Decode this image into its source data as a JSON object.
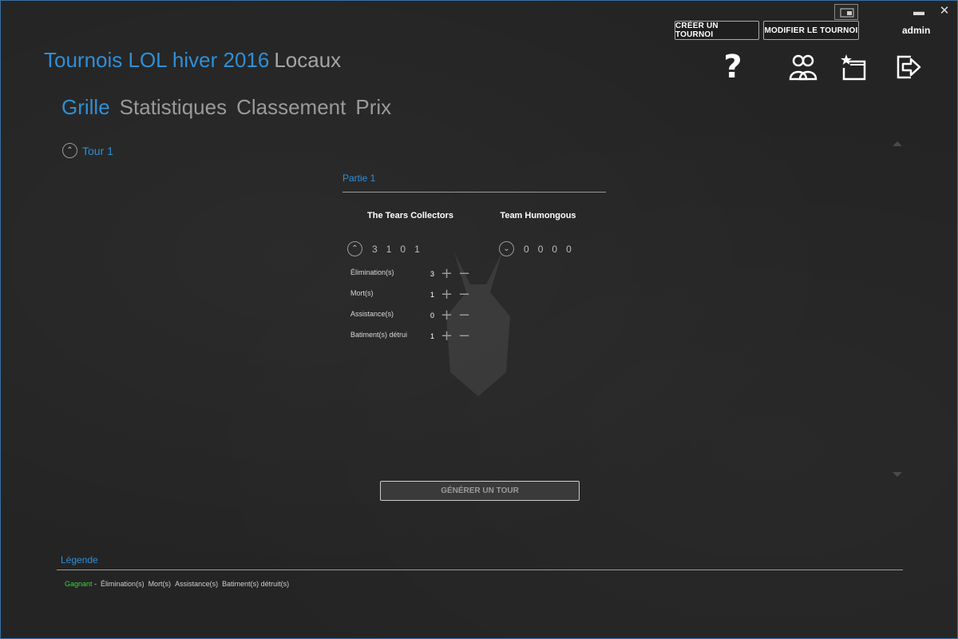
{
  "window": {
    "minimize_glyph": "▬",
    "close_glyph": "✕"
  },
  "header": {
    "create_button": "CRÉER UN TOURNOI",
    "modify_button": "MODIFIER LE TOURNOI",
    "user": "admin",
    "tournament_name": "Tournois LOL hiver 2016",
    "location": "Locaux",
    "help_glyph": "?",
    "icons": [
      "help-icon",
      "users-icon",
      "new-favorite-icon",
      "logout-icon"
    ]
  },
  "nav": {
    "tabs": [
      {
        "label": "Grille",
        "active": true
      },
      {
        "label": "Statistiques",
        "active": false
      },
      {
        "label": "Classement",
        "active": false
      },
      {
        "label": "Prix",
        "active": false
      }
    ]
  },
  "round": {
    "label": "Tour 1",
    "collapse_glyph": "⌃"
  },
  "match": {
    "title": "Partie 1",
    "team_a": {
      "name": "The Tears Collectors",
      "score": [
        "3",
        "1",
        "0",
        "1"
      ],
      "toggle_glyph": "⌃"
    },
    "team_b": {
      "name": "Team Humongous",
      "score": [
        "0",
        "0",
        "0",
        "0"
      ],
      "toggle_glyph": "⌄"
    },
    "stats": [
      {
        "label": "Élimination(s)",
        "value": "3"
      },
      {
        "label": "Mort(s)",
        "value": "1"
      },
      {
        "label": "Assistance(s)",
        "value": "0"
      },
      {
        "label": "Batiment(s) détrui",
        "value": "1"
      }
    ],
    "plus_glyph": "+",
    "minus_glyph": "−"
  },
  "generate_button": "GÉNÉRER UN TOUR",
  "legend": {
    "title": "Légende",
    "winner": "Gagnant",
    "separator": "-",
    "items": [
      "Élimination(s)",
      "Mort(s)",
      "Assistance(s)",
      "Batiment(s) détruit(s)"
    ]
  },
  "colors": {
    "accent": "#2f8fd6",
    "winner": "#39d13a",
    "background": "#242424"
  }
}
